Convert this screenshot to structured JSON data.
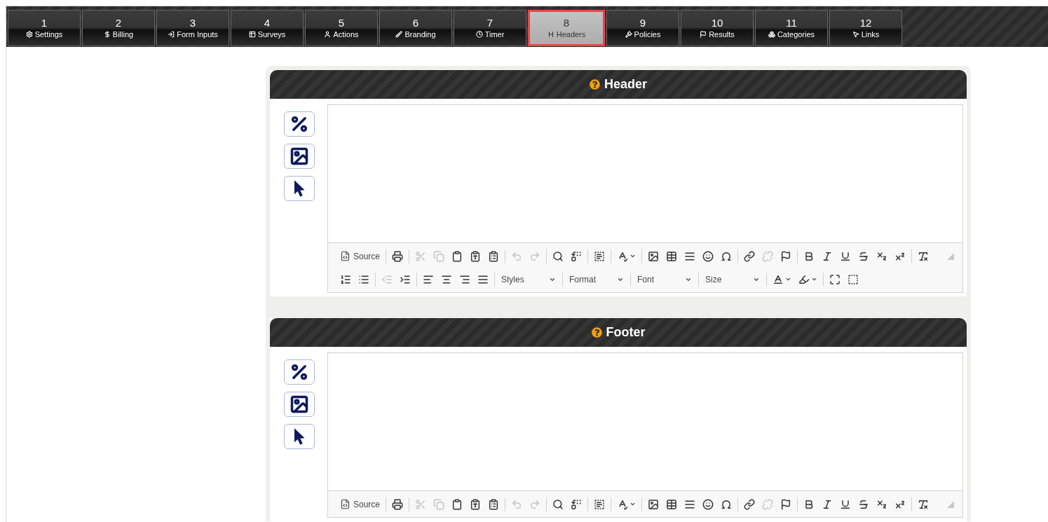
{
  "tabs": [
    {
      "number": "1",
      "label": "Settings",
      "selected": false
    },
    {
      "number": "2",
      "label": "Billing",
      "selected": false
    },
    {
      "number": "3",
      "label": "Form Inputs",
      "selected": false
    },
    {
      "number": "4",
      "label": "Surveys",
      "selected": false
    },
    {
      "number": "5",
      "label": "Actions",
      "selected": false
    },
    {
      "number": "6",
      "label": "Branding",
      "selected": false
    },
    {
      "number": "7",
      "label": "Timer",
      "selected": false
    },
    {
      "number": "8",
      "label": "Headers",
      "selected": true
    },
    {
      "number": "9",
      "label": "Policies",
      "selected": false
    },
    {
      "number": "10",
      "label": "Results",
      "selected": false
    },
    {
      "number": "11",
      "label": "Categories",
      "selected": false
    },
    {
      "number": "12",
      "label": "Links",
      "selected": false
    }
  ],
  "panels": [
    {
      "title": "Header",
      "toolbar_rows": [
        [
          {
            "kind": "text-button",
            "label": "Source"
          },
          {
            "kind": "separator"
          },
          {
            "kind": "button",
            "disabled": false
          },
          {
            "kind": "separator"
          },
          {
            "kind": "button",
            "disabled": true
          },
          {
            "kind": "button",
            "disabled": true
          },
          {
            "kind": "button",
            "disabled": false
          },
          {
            "kind": "button",
            "disabled": false
          },
          {
            "kind": "button",
            "disabled": false
          },
          {
            "kind": "separator"
          },
          {
            "kind": "button",
            "disabled": true
          },
          {
            "kind": "button",
            "disabled": true
          },
          {
            "kind": "separator"
          },
          {
            "kind": "button",
            "disabled": false
          },
          {
            "kind": "button",
            "disabled": false
          },
          {
            "kind": "separator"
          },
          {
            "kind": "button",
            "disabled": false
          },
          {
            "kind": "separator"
          },
          {
            "kind": "menu-button",
            "disabled": false
          },
          {
            "kind": "separator"
          },
          {
            "kind": "button",
            "disabled": false
          },
          {
            "kind": "button",
            "disabled": false
          },
          {
            "kind": "button",
            "disabled": false
          },
          {
            "kind": "button",
            "disabled": false
          },
          {
            "kind": "button",
            "disabled": false
          },
          {
            "kind": "separator"
          },
          {
            "kind": "button",
            "disabled": false
          },
          {
            "kind": "button",
            "disabled": true
          },
          {
            "kind": "button",
            "disabled": false
          },
          {
            "kind": "separator"
          },
          {
            "kind": "button",
            "disabled": false
          },
          {
            "kind": "button",
            "disabled": false
          },
          {
            "kind": "button",
            "disabled": false
          },
          {
            "kind": "button",
            "disabled": false
          },
          {
            "kind": "button",
            "disabled": false
          },
          {
            "kind": "button",
            "disabled": false
          },
          {
            "kind": "separator"
          },
          {
            "kind": "button",
            "disabled": false
          }
        ],
        [
          {
            "kind": "button",
            "disabled": false
          },
          {
            "kind": "button",
            "disabled": false
          },
          {
            "kind": "separator"
          },
          {
            "kind": "button",
            "disabled": true
          },
          {
            "kind": "button",
            "disabled": false
          },
          {
            "kind": "separator"
          },
          {
            "kind": "button",
            "disabled": false
          },
          {
            "kind": "button",
            "disabled": false
          },
          {
            "kind": "button",
            "disabled": false
          },
          {
            "kind": "button",
            "disabled": false
          },
          {
            "kind": "separator"
          },
          {
            "kind": "combo",
            "label": "Styles"
          },
          {
            "kind": "separator"
          },
          {
            "kind": "combo",
            "label": "Format"
          },
          {
            "kind": "separator"
          },
          {
            "kind": "combo",
            "label": "Font"
          },
          {
            "kind": "separator"
          },
          {
            "kind": "combo",
            "label": "Size"
          },
          {
            "kind": "separator"
          },
          {
            "kind": "menu-button",
            "disabled": false
          },
          {
            "kind": "menu-button",
            "disabled": false
          },
          {
            "kind": "separator"
          },
          {
            "kind": "button",
            "disabled": false
          },
          {
            "kind": "button",
            "disabled": false
          }
        ]
      ]
    },
    {
      "title": "Footer",
      "toolbar_rows": [
        [
          {
            "kind": "text-button",
            "label": "Source"
          },
          {
            "kind": "separator"
          },
          {
            "kind": "button",
            "disabled": false
          },
          {
            "kind": "separator"
          },
          {
            "kind": "button",
            "disabled": true
          },
          {
            "kind": "button",
            "disabled": true
          },
          {
            "kind": "button",
            "disabled": false
          },
          {
            "kind": "button",
            "disabled": false
          },
          {
            "kind": "button",
            "disabled": false
          },
          {
            "kind": "separator"
          },
          {
            "kind": "button",
            "disabled": true
          },
          {
            "kind": "button",
            "disabled": true
          },
          {
            "kind": "separator"
          },
          {
            "kind": "button",
            "disabled": false
          },
          {
            "kind": "button",
            "disabled": false
          },
          {
            "kind": "separator"
          },
          {
            "kind": "button",
            "disabled": false
          },
          {
            "kind": "separator"
          },
          {
            "kind": "menu-button",
            "disabled": false
          },
          {
            "kind": "separator"
          },
          {
            "kind": "button",
            "disabled": false
          },
          {
            "kind": "button",
            "disabled": false
          },
          {
            "kind": "button",
            "disabled": false
          },
          {
            "kind": "button",
            "disabled": false
          },
          {
            "kind": "button",
            "disabled": false
          },
          {
            "kind": "separator"
          },
          {
            "kind": "button",
            "disabled": false
          },
          {
            "kind": "button",
            "disabled": true
          },
          {
            "kind": "button",
            "disabled": false
          },
          {
            "kind": "separator"
          },
          {
            "kind": "button",
            "disabled": false
          },
          {
            "kind": "button",
            "disabled": false
          },
          {
            "kind": "button",
            "disabled": false
          },
          {
            "kind": "button",
            "disabled": false
          },
          {
            "kind": "button",
            "disabled": false
          },
          {
            "kind": "button",
            "disabled": false
          },
          {
            "kind": "separator"
          },
          {
            "kind": "button",
            "disabled": false
          }
        ]
      ]
    }
  ]
}
